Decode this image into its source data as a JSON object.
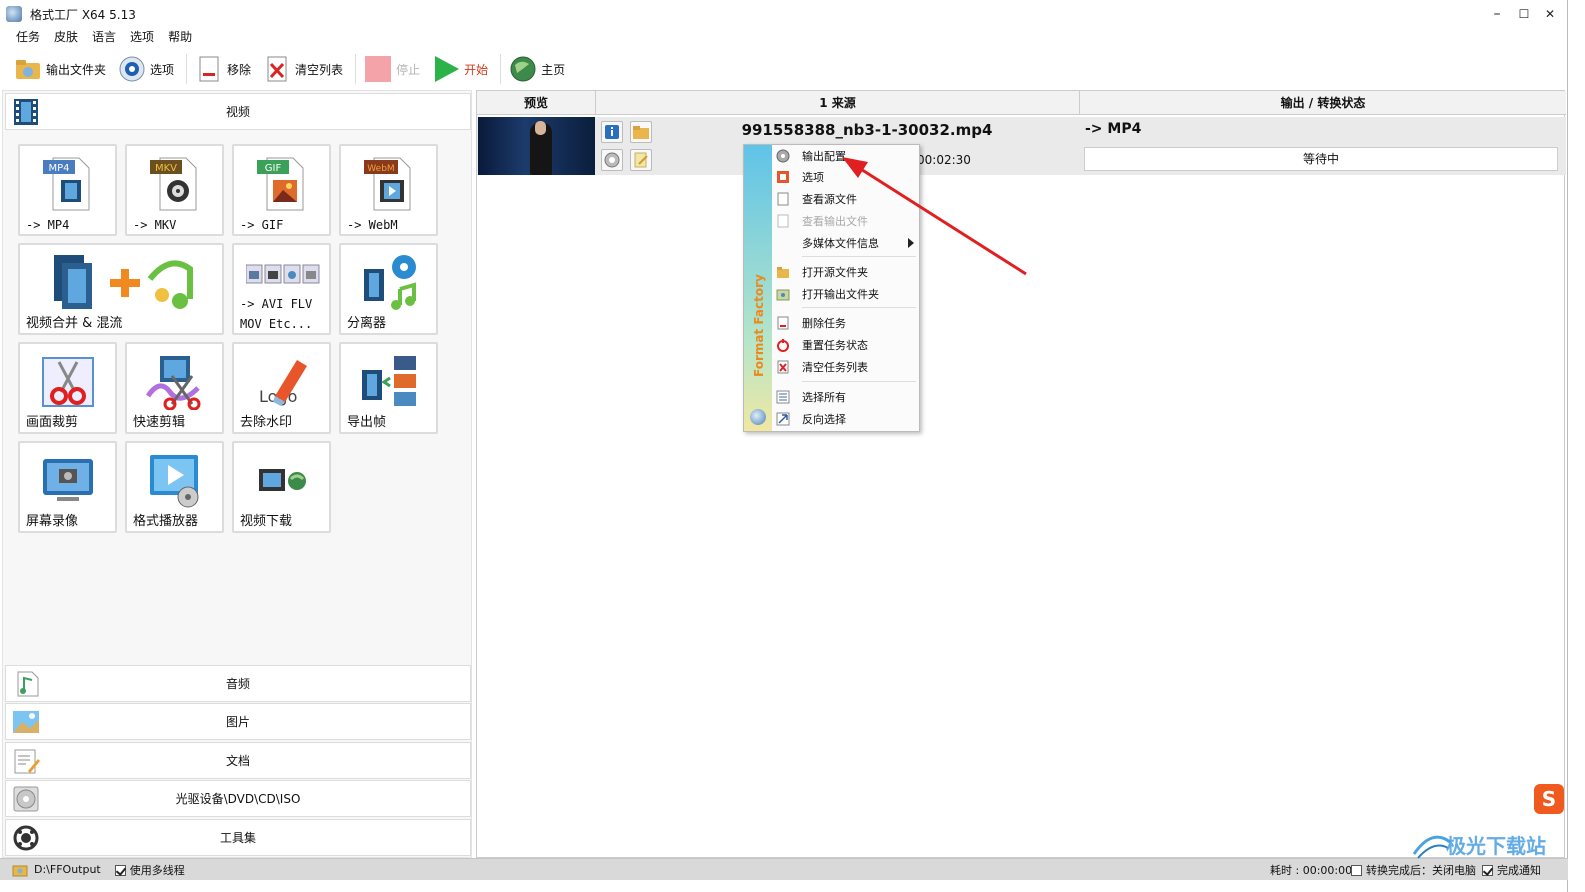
{
  "title": "格式工厂 X64 5.13",
  "window_controls": {
    "minimize": "–",
    "maximize": "☐",
    "close": "✕"
  },
  "menu": [
    "任务",
    "皮肤",
    "语言",
    "选项",
    "帮助"
  ],
  "toolbar": {
    "output_folder": "输出文件夹",
    "options": "选项",
    "remove": "移除",
    "clear_list": "清空列表",
    "stop": "停止",
    "start": "开始",
    "home": "主页"
  },
  "categories": {
    "video": "视频",
    "audio": "音频",
    "image": "图片",
    "document": "文档",
    "disc": "光驱设备\\DVD\\CD\\ISO",
    "toolbox": "工具集"
  },
  "tiles": [
    {
      "label": "-> MP4",
      "badge": "MP4",
      "icon": "mp4-file-icon"
    },
    {
      "label": "-> MKV",
      "badge": "MKV",
      "icon": "mkv-file-icon"
    },
    {
      "label": "-> GIF",
      "badge": "GIF",
      "icon": "gif-file-icon"
    },
    {
      "label": "-> WebM",
      "badge": "WebM",
      "icon": "webm-file-icon"
    },
    {
      "label": "视频合并 & 混流",
      "icon": "video-merge-icon"
    },
    {
      "label": "-> AVI FLV",
      "label2": "MOV Etc...",
      "icon": "other-formats-icon"
    },
    {
      "label": "分离器",
      "icon": "splitter-icon"
    },
    {
      "label": "画面裁剪",
      "icon": "crop-icon"
    },
    {
      "label": "快速剪辑",
      "icon": "quick-cut-icon"
    },
    {
      "label": "去除水印",
      "icon": "remove-watermark-icon",
      "logo_text": "Logo"
    },
    {
      "label": "导出帧",
      "icon": "export-frames-icon"
    },
    {
      "label": "屏幕录像",
      "icon": "screen-record-icon"
    },
    {
      "label": "格式播放器",
      "icon": "player-icon"
    },
    {
      "label": "视频下载",
      "icon": "video-download-icon"
    }
  ],
  "table": {
    "headers": {
      "preview": "预览",
      "source": "1 来源",
      "output": "输出 / 转换状态"
    },
    "rows": [
      {
        "filename": "991558388_nb3-1-30032.mp4",
        "duration": "00:02:30",
        "output_format": "-> MP4",
        "status": "等待中"
      }
    ]
  },
  "context_menu": {
    "brand": "Format Factory",
    "items": [
      {
        "label": "输出配置",
        "icon": "gear-icon",
        "enabled": true
      },
      {
        "label": "选项",
        "icon": "options-icon",
        "enabled": true
      },
      {
        "label": "查看源文件",
        "icon": "file-icon",
        "enabled": true
      },
      {
        "label": "查看输出文件",
        "icon": "file-icon",
        "enabled": false
      },
      {
        "label": "多媒体文件信息",
        "icon": "submenu-arrow-icon",
        "enabled": true
      },
      {
        "label": "打开源文件夹",
        "icon": "folder-icon",
        "enabled": true
      },
      {
        "label": "打开输出文件夹",
        "icon": "output-folder-icon",
        "enabled": true
      },
      {
        "label": "删除任务",
        "icon": "delete-icon",
        "enabled": true
      },
      {
        "label": "重置任务状态",
        "icon": "reset-icon",
        "enabled": true
      },
      {
        "label": "清空任务列表",
        "icon": "clear-icon",
        "enabled": true
      },
      {
        "label": "选择所有",
        "icon": "select-all-icon",
        "enabled": true
      },
      {
        "label": "反向选择",
        "icon": "invert-selection-icon",
        "enabled": true
      }
    ]
  },
  "statusbar": {
    "output_path": "D:\\FFOutput",
    "multithread": "使用多线程",
    "multithread_checked": true,
    "elapsed": "耗时 : 00:00:00",
    "after_done": "转换完成后：关闭电脑",
    "after_done_checked": false,
    "notify": "完成通知",
    "notify_checked": true
  },
  "watermark": {
    "text": "极光下载站"
  },
  "colors": {
    "start_green": "#2bb34a",
    "stop_disabled": "#f4a3a8",
    "arrow_red": "#e02020",
    "brand_orange": "#e98a1f"
  }
}
